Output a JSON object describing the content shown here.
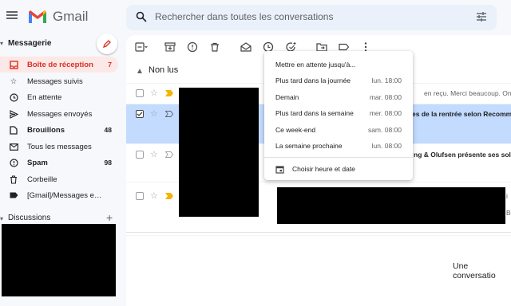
{
  "app": {
    "brand": "Gmail"
  },
  "search": {
    "placeholder": "Rechercher dans toutes les conversations"
  },
  "sidebar": {
    "title": "Messagerie",
    "items": [
      {
        "label": "Boîte de réception",
        "count": "7",
        "icon": "inbox-icon"
      },
      {
        "label": "Messages suivis",
        "count": "",
        "icon": "star-icon"
      },
      {
        "label": "En attente",
        "count": "",
        "icon": "clock-icon"
      },
      {
        "label": "Messages envoyés",
        "count": "",
        "icon": "send-icon"
      },
      {
        "label": "Brouillons",
        "count": "48",
        "icon": "draft-icon"
      },
      {
        "label": "Tous les messages",
        "count": "",
        "icon": "mail-icon"
      },
      {
        "label": "Spam",
        "count": "98",
        "icon": "spam-icon"
      },
      {
        "label": "Corbeille",
        "count": "",
        "icon": "trash-icon"
      },
      {
        "label": "[Gmail]/Messages envo...",
        "count": "",
        "icon": "label-icon"
      }
    ],
    "discussions": "Discussions"
  },
  "main": {
    "section": "Non lus",
    "rows": [
      {
        "snippet": "en reçu. Merci beaucoup. On",
        "selected": false
      },
      {
        "snippet": "es de la rentrée selon Recomm",
        "selected": true
      },
      {
        "snippet": "ng & Olufsen présente ses solu",
        "selected": false
      },
      {
        "snippet": "",
        "selected": false
      }
    ],
    "right_fragment_1": "i",
    "right_fragment_2": "B",
    "empty_message": "Une conversatio"
  },
  "snooze_menu": {
    "title": "Mettre en attente jusqu'à...",
    "options": [
      {
        "label": "Plus tard dans la journée",
        "when": "lun. 18:00"
      },
      {
        "label": "Demain",
        "when": "mar. 08:00"
      },
      {
        "label": "Plus tard dans la semaine",
        "when": "mer. 08:00"
      },
      {
        "label": "Ce week-end",
        "when": "sam. 08:00"
      },
      {
        "label": "La semaine prochaine",
        "when": "lun. 08:00"
      }
    ],
    "custom": "Choisir heure et date"
  },
  "colors": {
    "accent": "#d93025",
    "selected_row": "#c2dbff",
    "important": "#f4b400"
  }
}
